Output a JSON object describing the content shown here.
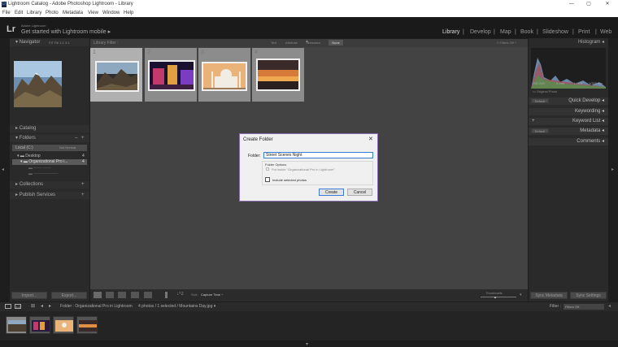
{
  "window": {
    "title": "Lightroom Catalog - Adobe Photoshop Lightroom - Library",
    "controls": [
      "—",
      "▢",
      "✕"
    ]
  },
  "menu": [
    "File",
    "Edit",
    "Library",
    "Photo",
    "Metadata",
    "View",
    "Window",
    "Help"
  ],
  "identity": {
    "logo": "Lr",
    "small": "Adobe Lightroom",
    "mobile": "Get started with Lightroom mobile",
    "mobile_arrow": "▸"
  },
  "modules": [
    "Library",
    "Develop",
    "Map",
    "Book",
    "Slideshow",
    "Print",
    "Web"
  ],
  "module_sep": "|",
  "left": {
    "navigator": {
      "label": "Navigator",
      "zooms": "FIT   Fill   1:1   3:1"
    },
    "catalog": "Catalog",
    "folders": "Folders",
    "volume": "Local (C:)",
    "volume_info": "Not Normal",
    "folder_rows": [
      {
        "name": "Desktop",
        "count": "4"
      },
      {
        "name": "Organizational Pro i...",
        "count": "4"
      },
      {
        "name": "—— ——",
        "count": ""
      },
      {
        "name": "——————",
        "count": ""
      }
    ],
    "collections": "Collections",
    "publish": "Publish Services",
    "plus": "+",
    "minus": "–",
    "import": "Import...",
    "export": "Export..."
  },
  "right": {
    "histogram": "Histogram",
    "hist_info": [
      "ISO 200",
      "0 mm",
      "f / 4.0",
      "1/320 sec"
    ],
    "original": "Original Photo",
    "quick_develop": "Quick Develop",
    "keywording": "Keywording",
    "keyword_list": "Keyword List",
    "metadata": "Metadata",
    "comments": "Comments",
    "default": "Default",
    "sync_metadata": "Sync Metadata",
    "sync_settings": "Sync Settings"
  },
  "filter": {
    "label": "Library Filter :",
    "options": [
      "Text",
      "Attribute",
      "Metadata",
      "None"
    ],
    "status": "≡ Filters Off ÷"
  },
  "toolbar": {
    "sort_label": "Sort:",
    "sort_value": "Capture Time ÷",
    "thumbs": "Thumbnails"
  },
  "filmbar": {
    "pages": "1  2",
    "path": "Folder : Organizational Pro in Lightroom",
    "info": "4 photos / 1 selected / Mountains Day.jpg ▾",
    "filter_label": "Filter :",
    "filter_value": "Filters Off"
  },
  "dialog": {
    "title": "Create Folder",
    "folder_label": "Folder:",
    "folder_value": "Street Scenes Night",
    "options_title": "Folder Options",
    "put_inside": "Put inside \"Organizational Pro in Lightroom\"",
    "include": "Include selected photos",
    "create": "Create",
    "cancel": "Cancel",
    "close": "✕"
  },
  "colors": {
    "accent": "#8a6fae",
    "panel": "#2a2a2a",
    "grid": "#434343",
    "selected_cell": "#b0b0b0"
  }
}
